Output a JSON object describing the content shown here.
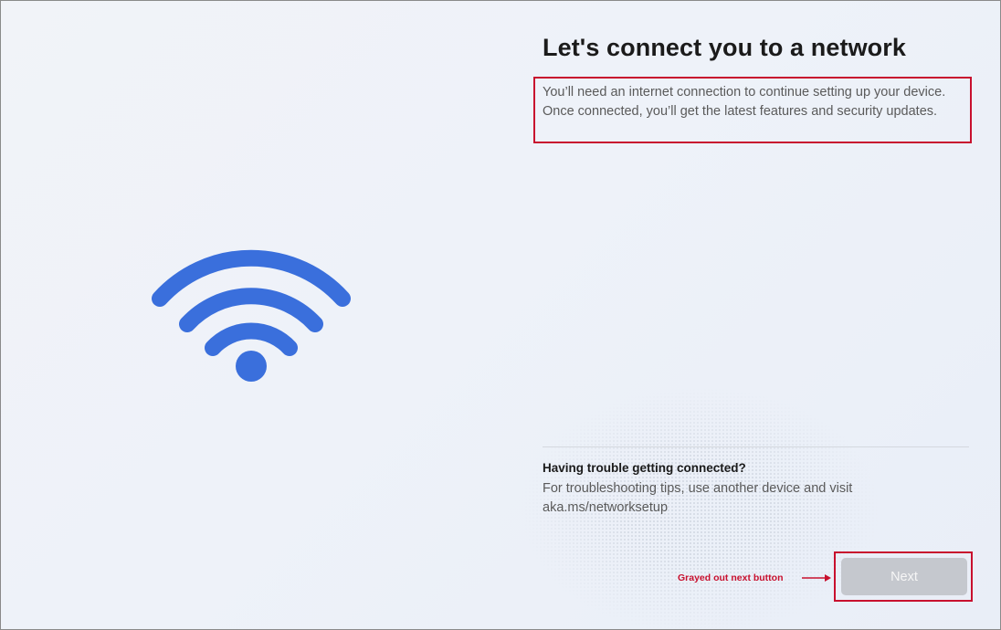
{
  "page": {
    "title": "Let's connect you to a network",
    "description": "You’ll need an internet connection to continue setting up your device. Once connected, you’ll get the latest features and security updates."
  },
  "trouble": {
    "heading": "Having trouble getting connected?",
    "text": "For troubleshooting tips, use another device and visit aka.ms/networksetup"
  },
  "buttons": {
    "next_label": "Next",
    "next_disabled": true
  },
  "annotation": {
    "label": "Grayed out next button"
  },
  "icons": {
    "hero": "wifi-icon"
  },
  "colors": {
    "wifi_accent": "#3a6fdc",
    "highlight_border": "#c8102e",
    "disabled_button": "#c5c8ce"
  }
}
